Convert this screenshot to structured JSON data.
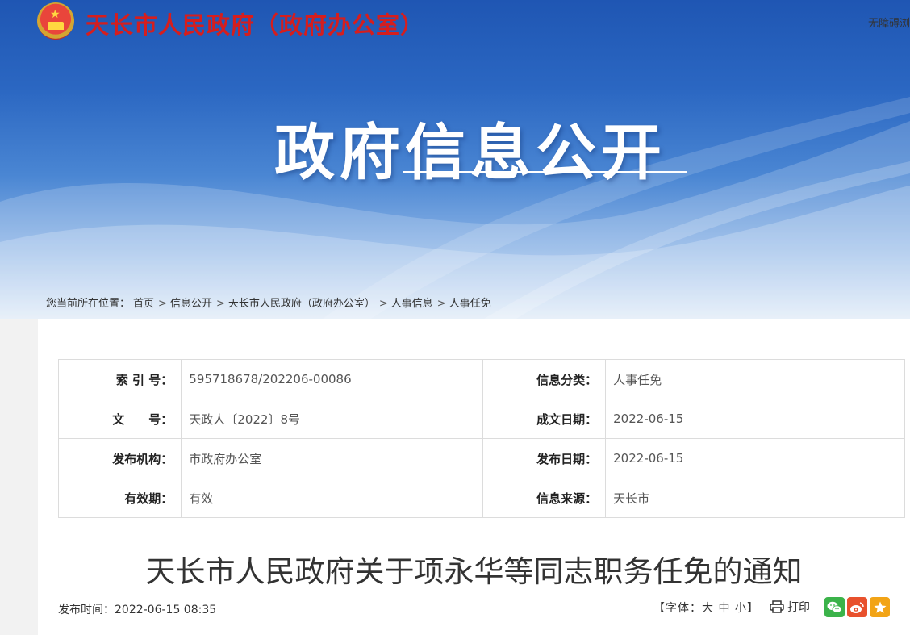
{
  "header": {
    "site_title": "天长市人民政府（政府办公室）",
    "accessibility_link": "无障碍浏",
    "banner_title": "政府信息公开"
  },
  "breadcrumb": {
    "prefix": "您当前所在位置：",
    "items": [
      "首页",
      "信息公开",
      "天长市人民政府（政府办公室）",
      "人事信息",
      "人事任免"
    ],
    "separator": ">"
  },
  "meta": {
    "rows": [
      {
        "label1": "索 引 号：",
        "value1": "595718678/202206-00086",
        "label2": "信息分类：",
        "value2": "人事任免"
      },
      {
        "label1": "文　　号：",
        "value1": "天政人〔2022〕8号",
        "label2": "成文日期：",
        "value2": "2022-06-15"
      },
      {
        "label1": "发布机构：",
        "value1": "市政府办公室",
        "label2": "发布日期：",
        "value2": "2022-06-15"
      },
      {
        "label1": "有效期：",
        "value1": "有效",
        "label2": "信息来源：",
        "value2": "天长市"
      }
    ]
  },
  "article": {
    "title": "天长市人民政府关于项永华等同志职务任免的通知",
    "publish_time": "发布时间：2022-06-15 08:35"
  },
  "tools": {
    "font_prefix": "【字体：",
    "font_large": "大",
    "font_medium": "中",
    "font_small": "小",
    "font_suffix": "】",
    "print_label": "打印"
  },
  "icons": {
    "emblem": "national-emblem-icon",
    "print": "printer-icon",
    "wechat": "wechat-icon",
    "weibo": "weibo-icon",
    "favorite": "star-icon"
  },
  "colors": {
    "site_title": "#d51e1e",
    "banner_blue": "#2b67c2",
    "wechat": "#3bb34a",
    "weibo": "#e8512d",
    "favorite": "#f2a416"
  }
}
